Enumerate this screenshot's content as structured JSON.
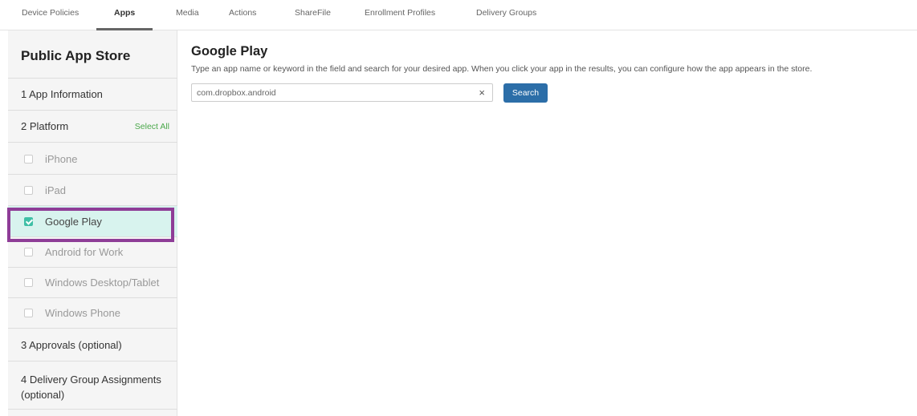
{
  "nav": {
    "tabs": [
      {
        "label": "Device Policies"
      },
      {
        "label": "Apps"
      },
      {
        "label": "Media"
      },
      {
        "label": "Actions"
      },
      {
        "label": "ShareFile"
      },
      {
        "label": "Enrollment Profiles"
      },
      {
        "label": "Delivery Groups"
      }
    ],
    "active_tab": "Apps"
  },
  "sidebar": {
    "title": "Public App Store",
    "steps": {
      "app_information": "1 App Information",
      "platform": "2 Platform",
      "select_all": "Select All",
      "approvals": "3 Approvals (optional)",
      "delivery_group_line1": "4 Delivery Group Assignments",
      "delivery_group_line2": "(optional)"
    },
    "platforms": [
      {
        "label": "iPhone",
        "checked": false
      },
      {
        "label": "iPad",
        "checked": false
      },
      {
        "label": "Google Play",
        "checked": true
      },
      {
        "label": "Android for Work",
        "checked": false
      },
      {
        "label": "Windows Desktop/Tablet",
        "checked": false
      },
      {
        "label": "Windows Phone",
        "checked": false
      }
    ]
  },
  "main": {
    "title": "Google Play",
    "description": "Type an app name or keyword in the field and search for your desired app. When you click your app in the results, you can configure how the app appears in the store.",
    "search": {
      "value": "com.dropbox.android",
      "clear_icon": "×",
      "button_label": "Search"
    }
  },
  "colors": {
    "accent_purple": "#8e3d97",
    "selected_bg": "#d8f3ee",
    "checkbox_teal": "#3fbfa6",
    "search_button": "#2c6ea8",
    "select_all_green": "#4aa84a"
  }
}
